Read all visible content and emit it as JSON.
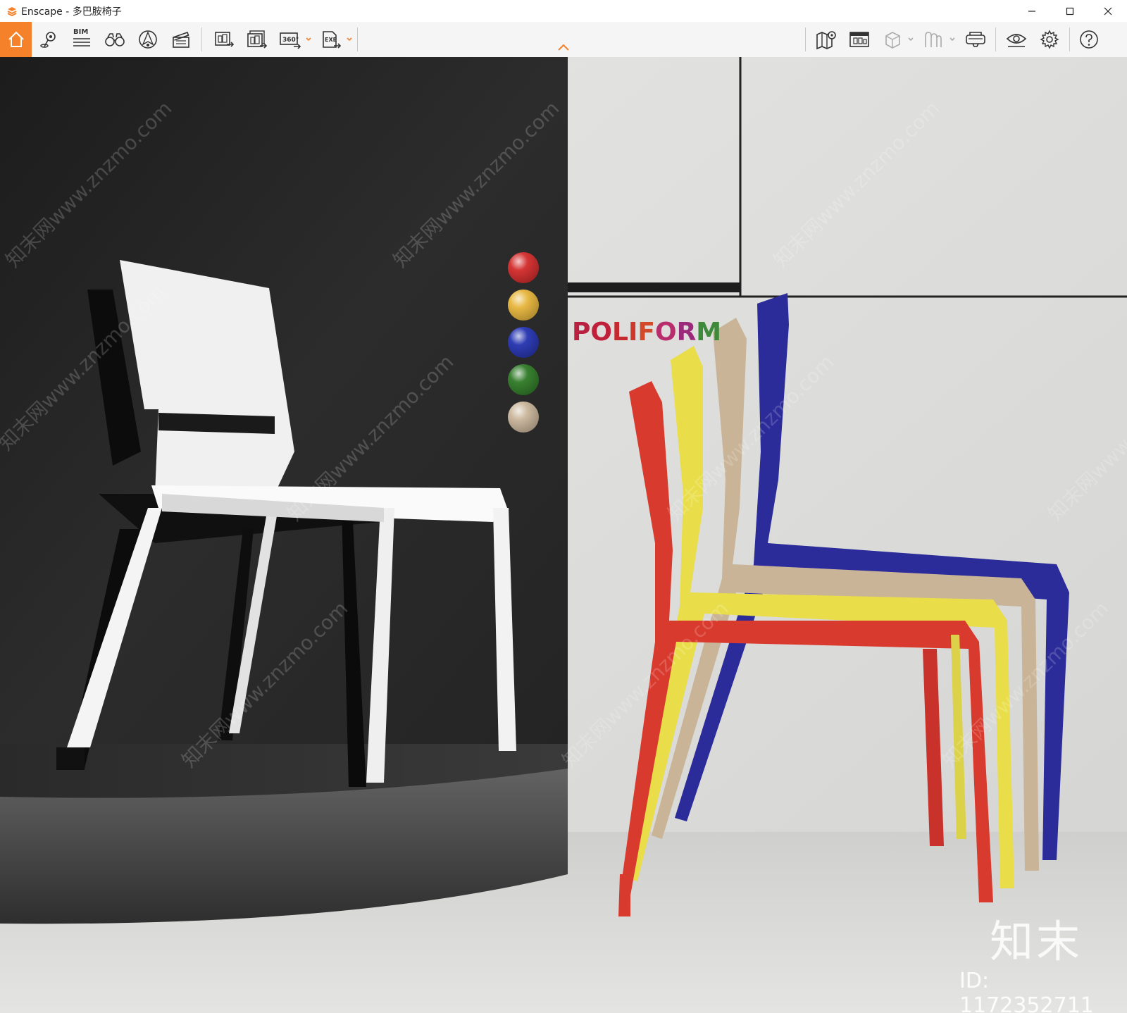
{
  "window": {
    "app_name": "Enscape",
    "separator": " - ",
    "project_name": "多巴胺椅子",
    "minimize_icon": "minimize-icon",
    "maximize_icon": "maximize-icon",
    "close_icon": "close-icon"
  },
  "toolbar": {
    "left_tools": [
      {
        "icon": "home-icon",
        "active": true
      },
      {
        "icon": "location-pin-icon"
      },
      {
        "icon": "bim-icon",
        "label": "BIM"
      },
      {
        "icon": "binoculars-icon"
      },
      {
        "icon": "compass-icon"
      },
      {
        "icon": "clapperboard-icon"
      },
      {
        "icon": "render-screenshot-icon"
      },
      {
        "icon": "batch-render-icon"
      },
      {
        "icon": "panorama-360-icon",
        "label": "360°"
      },
      {
        "icon": "export-exe-icon",
        "label": "EXE"
      }
    ],
    "right_tools": [
      {
        "icon": "map-icon"
      },
      {
        "icon": "asset-library-icon"
      },
      {
        "icon": "view-cube-icon"
      },
      {
        "icon": "material-editor-icon"
      },
      {
        "icon": "vr-headset-icon"
      },
      {
        "icon": "visual-settings-eye-icon"
      },
      {
        "icon": "settings-gear-icon"
      },
      {
        "icon": "help-icon"
      }
    ],
    "accent_color": "#f5822a"
  },
  "viewport": {
    "brand_letters": [
      {
        "ch": "P",
        "color": "#b8213f"
      },
      {
        "ch": "O",
        "color": "#c0203a"
      },
      {
        "ch": "L",
        "color": "#c62a30"
      },
      {
        "ch": "I",
        "color": "#cc3a2c"
      },
      {
        "ch": "F",
        "color": "#d24a2a"
      },
      {
        "ch": "O",
        "color": "#b82e6c"
      },
      {
        "ch": "R",
        "color": "#9c2a7a"
      },
      {
        "ch": "M",
        "color": "#3c8a3a"
      }
    ],
    "color_swatches": [
      "#d32a2a",
      "#e7b53a",
      "#2433b0",
      "#2f7a26",
      "#c9b59a"
    ],
    "watermark_logo": "知末",
    "watermark_id": "ID: 1172352711",
    "watermark_text": "知末网www.znzmo.com"
  }
}
